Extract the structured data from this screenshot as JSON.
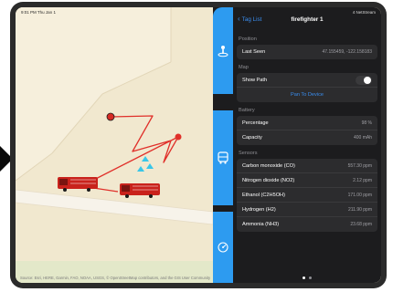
{
  "status_bar": {
    "left": "9:01 PM   Thu Jan 1",
    "right": "4 NetStream"
  },
  "map": {
    "attribution": "Source: Esri, HERE, Garmin, FAO, NOAA, USGS, © OpenStreetMap contributors, and the GIS User Community"
  },
  "rail": {
    "icons": [
      "person-location-icon",
      "bus-icon",
      "sensor-dial-icon"
    ]
  },
  "nav": {
    "back_label": "Tag List",
    "title": "firefighter 1"
  },
  "position": {
    "section": "Position",
    "last_seen_label": "Last Seen",
    "last_seen_value": "47.155459, -122.158183"
  },
  "map_settings": {
    "section": "Map",
    "show_path_label": "Show Path",
    "show_path_on": true,
    "pan_label": "Pan To Device"
  },
  "battery": {
    "section": "Battery",
    "rows": [
      {
        "label": "Percentage",
        "value": "98 %"
      },
      {
        "label": "Capacity",
        "value": "400 mAh"
      }
    ]
  },
  "sensors": {
    "section": "Sensors",
    "rows": [
      {
        "label": "Carbon monoxide (CO)",
        "value": "557.30 ppm"
      },
      {
        "label": "Nitrogen dioxide (NO2)",
        "value": "2.12 ppm"
      },
      {
        "label": "Ethanol (C2H5OH)",
        "value": "171.00 ppm"
      },
      {
        "label": "Hydrogen (H2)",
        "value": "211.90 ppm"
      },
      {
        "label": "Ammonia (NH3)",
        "value": "23.68 ppm"
      }
    ]
  },
  "pager": {
    "count": 2,
    "active": 0
  },
  "colors": {
    "accent": "#3a8ef0",
    "rail_blue": "#2d9bf0",
    "path_red": "#e0302a",
    "panel_bg": "#1c1c1e"
  }
}
